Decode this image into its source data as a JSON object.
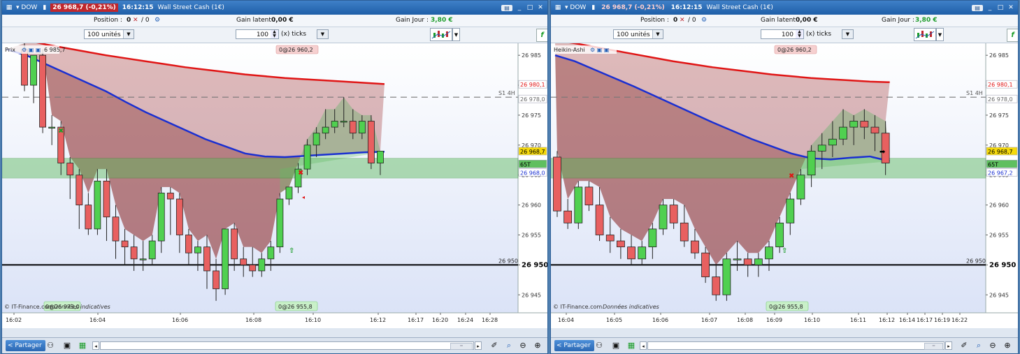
{
  "windows": [
    {
      "id": "left",
      "title": {
        "symbol": "DOW",
        "price_badge": "26 968,7 (-0,21%)",
        "time": "16:12:15",
        "instrument": "Wall Street Cash (1€)"
      },
      "info": {
        "position_label": "Position :",
        "position_value": "0",
        "position_orders": "/ 0",
        "gain_latent_label": "Gain latent :",
        "gain_latent_value": "0,00 €",
        "gain_jour_label": "Gain Jour :",
        "gain_jour_value": "3,80 €"
      },
      "toolbar": {
        "units": "100 unités",
        "ticks_value": "100",
        "ticks_label": "(x) ticks"
      },
      "chart": {
        "legend": "Prix",
        "legend_value": "6 985,7",
        "top_tag": "0@26 960,2",
        "bottom_tag": "0@26 955,8",
        "bottom_left_tag": "0@26 973,0",
        "copyright": "© IT-Finance.com",
        "copyright_italic": "Données indicatives",
        "s1_label": "S1 4H",
        "level_26950_label": "26 950",
        "right_tags": {
          "red": "26 980,1",
          "gray": "26 978,0",
          "price": "26 968,7",
          "tick": "65T",
          "blue": "26 968,0"
        },
        "y_ticks": [
          "26 985",
          "26 980",
          "26 975",
          "26 970",
          "26 965",
          "26 960",
          "26 955",
          "26 950",
          "26 945"
        ],
        "x_ticks": [
          "16:02",
          "16:04",
          "16:06",
          "16:08",
          "16:10",
          "16:12",
          "16:17",
          "16:20",
          "16:24",
          "16:28"
        ]
      },
      "bottom": {
        "share_label": "Partager"
      }
    },
    {
      "id": "right",
      "title": {
        "symbol": "DOW",
        "price_badge": "26 968,7 (-0,21%)",
        "time": "16:12:15",
        "instrument": "Wall Street Cash (1€)"
      },
      "info": {
        "position_label": "Position :",
        "position_value": "0",
        "position_orders": "/ 0",
        "gain_latent_label": "Gain latent :",
        "gain_latent_value": "0,00 €",
        "gain_jour_label": "Gain Jour :",
        "gain_jour_value": "3,80 €"
      },
      "toolbar": {
        "units": "100 unités",
        "ticks_value": "100",
        "ticks_label": "(x) ticks"
      },
      "chart": {
        "legend": "Heikin-Ashi",
        "legend_value": "",
        "top_tag": "0@26 960,2",
        "bottom_tag": "0@26 955,8",
        "bottom_left_tag": "",
        "copyright": "© IT-Finance.com",
        "copyright_italic": "Données indicatives",
        "s1_label": "S1 4H",
        "level_26950_label": "26 950",
        "right_tags": {
          "red": "26 980,1",
          "gray": "26 978,0",
          "price": "26 968,7",
          "tick": "65T",
          "blue": "26 967,2"
        },
        "y_ticks": [
          "26 985",
          "26 980",
          "26 975",
          "26 970",
          "26 965",
          "26 960",
          "26 955",
          "26 950",
          "26 945"
        ],
        "x_ticks": [
          "16:04",
          "16:05",
          "16:06",
          "16:07",
          "16:08",
          "16:09",
          "16:10",
          "16:11",
          "16:12",
          "16:14",
          "16:17",
          "16:19",
          "16:22"
        ]
      },
      "bottom": {
        "share_label": "Partager"
      }
    }
  ],
  "chart_data": [
    {
      "type": "candlestick",
      "title": "Prix",
      "ylim": [
        26942,
        26987
      ],
      "levels": {
        "s1_4h": 26978,
        "support": 26950,
        "zone": [
          26964.5,
          26967.8
        ]
      },
      "candles": [
        [
          26986,
          26987,
          26979,
          26980
        ],
        [
          26980,
          26984,
          26977,
          26985
        ],
        [
          26985,
          26986,
          26972,
          26973
        ],
        [
          26973,
          26975,
          26970,
          26973
        ],
        [
          26973,
          26974,
          26965,
          26967
        ],
        [
          26967,
          26968,
          26961,
          26965
        ],
        [
          26965,
          26966,
          26956,
          26960
        ],
        [
          26960,
          26962,
          26955,
          26956
        ],
        [
          26956,
          26966,
          26955,
          26964
        ],
        [
          26964,
          26966,
          26954,
          26958
        ],
        [
          26958,
          26960,
          26951,
          26954
        ],
        [
          26954,
          26956,
          26950,
          26953
        ],
        [
          26953,
          26955,
          26949,
          26951
        ],
        [
          26951,
          26954,
          26949,
          26951
        ],
        [
          26951,
          26955,
          26950,
          26954
        ],
        [
          26954,
          26963,
          26952,
          26962
        ],
        [
          26962,
          26963,
          26955,
          26961
        ],
        [
          26961,
          26962,
          26952,
          26955
        ],
        [
          26955,
          26956,
          26950,
          26952
        ],
        [
          26952,
          26954,
          26949,
          26953
        ],
        [
          26953,
          26955,
          26946,
          26949
        ],
        [
          26949,
          26951,
          26944,
          26946
        ],
        [
          26946,
          26956,
          26945,
          26956
        ],
        [
          26956,
          26957,
          26949,
          26951
        ],
        [
          26951,
          26953,
          26948,
          26950
        ],
        [
          26950,
          26953,
          26948,
          26949
        ],
        [
          26949,
          26952,
          26948,
          26951
        ],
        [
          26951,
          26954,
          26949,
          26953
        ],
        [
          26953,
          26962,
          26952,
          26961
        ],
        [
          26961,
          26963,
          26960,
          26963
        ],
        [
          26963,
          26967,
          26962,
          26966
        ],
        [
          26966,
          26971,
          26965,
          26970
        ],
        [
          26970,
          26973,
          26968,
          26972
        ],
        [
          26972,
          26976,
          26971,
          26973
        ],
        [
          26973,
          26976,
          26972,
          26974
        ],
        [
          26974,
          26978,
          26973,
          26974
        ],
        [
          26974,
          26976,
          26971,
          26972
        ],
        [
          26972,
          26975,
          26971,
          26974
        ],
        [
          26974,
          26975,
          26966,
          26967
        ],
        [
          26967,
          26969,
          26965,
          26969
        ]
      ],
      "ema_red": [
        26988,
        26987.5,
        26986.8,
        26986.2,
        26985.6,
        26985,
        26984.5,
        26984,
        26983.5,
        26983,
        26982.6,
        26982.2,
        26981.8,
        26981.5,
        26981.2,
        26981,
        26980.8,
        26980.6,
        26980.4,
        26980.2
      ],
      "ema_blue": [
        26986,
        26985,
        26983.5,
        26982,
        26980.5,
        26979,
        26977.2,
        26975.5,
        26974,
        26972.5,
        26971,
        26969.8,
        26968.6,
        26968.1,
        26968,
        26968.2,
        26968.4,
        26968.6,
        26968.8,
        26968.9
      ]
    },
    {
      "type": "candlestick",
      "title": "Heikin-Ashi",
      "ylim": [
        26942,
        26987
      ],
      "levels": {
        "s1_4h": 26978,
        "support": 26950,
        "zone": [
          26964.5,
          26967.8
        ]
      },
      "candles": [
        [
          26968,
          26969,
          26958,
          26959
        ],
        [
          26959,
          26961,
          26956,
          26957
        ],
        [
          26957,
          26964,
          26956,
          26963
        ],
        [
          26963,
          26964,
          26959,
          26960
        ],
        [
          26960,
          26963,
          26954,
          26955
        ],
        [
          26955,
          26958,
          26952,
          26954
        ],
        [
          26954,
          26956,
          26951,
          26953
        ],
        [
          26953,
          26955,
          26950,
          26951
        ],
        [
          26951,
          26954,
          26950,
          26953
        ],
        [
          26953,
          26957,
          26951,
          26956
        ],
        [
          26956,
          26961,
          26955,
          26960
        ],
        [
          26960,
          26961,
          26956,
          26957
        ],
        [
          26957,
          26960,
          26953,
          26954
        ],
        [
          26954,
          26956,
          26951,
          26952
        ],
        [
          26952,
          26953,
          26947,
          26948
        ],
        [
          26948,
          26950,
          26944,
          26945
        ],
        [
          26945,
          26952,
          26944,
          26951
        ],
        [
          26951,
          26954,
          26949,
          26951
        ],
        [
          26951,
          26952,
          26948,
          26950
        ],
        [
          26950,
          26952,
          26948,
          26951
        ],
        [
          26951,
          26954,
          26949,
          26953
        ],
        [
          26953,
          26958,
          26952,
          26957
        ],
        [
          26957,
          26962,
          26955,
          26961
        ],
        [
          26961,
          26966,
          26960,
          26965
        ],
        [
          26965,
          26970,
          26963,
          26969
        ],
        [
          26969,
          26972,
          26966,
          26970
        ],
        [
          26970,
          26974,
          26968,
          26971
        ],
        [
          26971,
          26976,
          26970,
          26973
        ],
        [
          26973,
          26975,
          26970,
          26974
        ],
        [
          26974,
          26976,
          26971,
          26973
        ],
        [
          26973,
          26975,
          26969,
          26972
        ],
        [
          26972,
          26974,
          26965,
          26967
        ]
      ],
      "ema_red": [
        26987.5,
        26987,
        26986.4,
        26985.8,
        26985.2,
        26984.6,
        26984,
        26983.5,
        26983,
        26982.6,
        26982.2,
        26981.8,
        26981.5,
        26981.2,
        26981,
        26980.8,
        26980.6,
        26980.5
      ],
      "ema_blue": [
        26985,
        26984,
        26982.6,
        26981.2,
        26979.8,
        26978.3,
        26976.8,
        26975.3,
        26973.8,
        26972.4,
        26971,
        26969.8,
        26968.6,
        26967.8,
        26967.6,
        26967.9,
        26968.1,
        26967.3
      ]
    }
  ]
}
